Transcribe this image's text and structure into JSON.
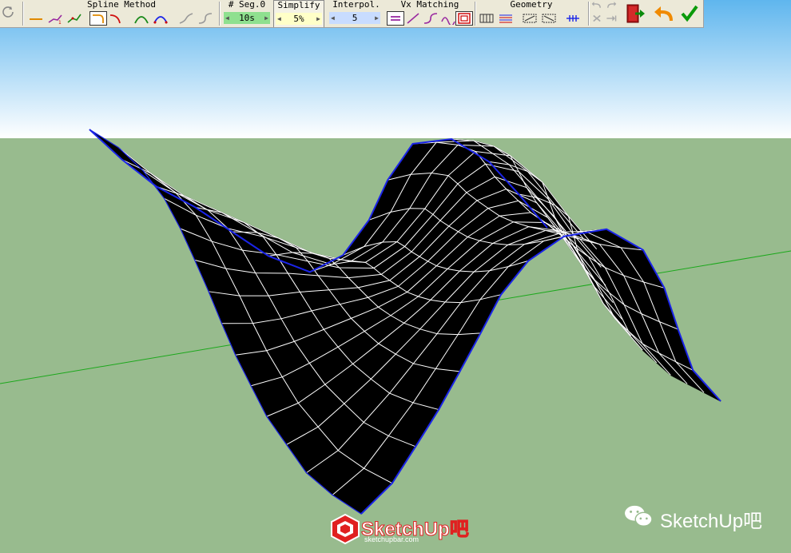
{
  "toolbar": {
    "spline_method": {
      "title": "Spline Method"
    },
    "segments": {
      "title": "# Seg.0",
      "value": "10s"
    },
    "simplify": {
      "title": "Simplify",
      "value": "5%"
    },
    "interpol": {
      "title": "Interpol.",
      "value": "5"
    },
    "vx_matching": {
      "title": "Vx Matching"
    },
    "geometry": {
      "title": "Geometry"
    }
  },
  "watermark": {
    "logo_text": "SketchUp吧",
    "logo_url_text": "sketchupbar.com",
    "wechat_text": "SketchUp吧"
  },
  "colors": {
    "sky_top": "#5fb6ee",
    "sky_bottom": "#ffffff",
    "ground": "#98bb8e",
    "surface": "#000000",
    "wire": "#ffffff",
    "edge": "#1a24e8",
    "axis": "#1ca81c",
    "seg_spin": "#8fe08f",
    "simplify_spin": "#ffffc8",
    "interpol_spin": "#c8dcff"
  }
}
